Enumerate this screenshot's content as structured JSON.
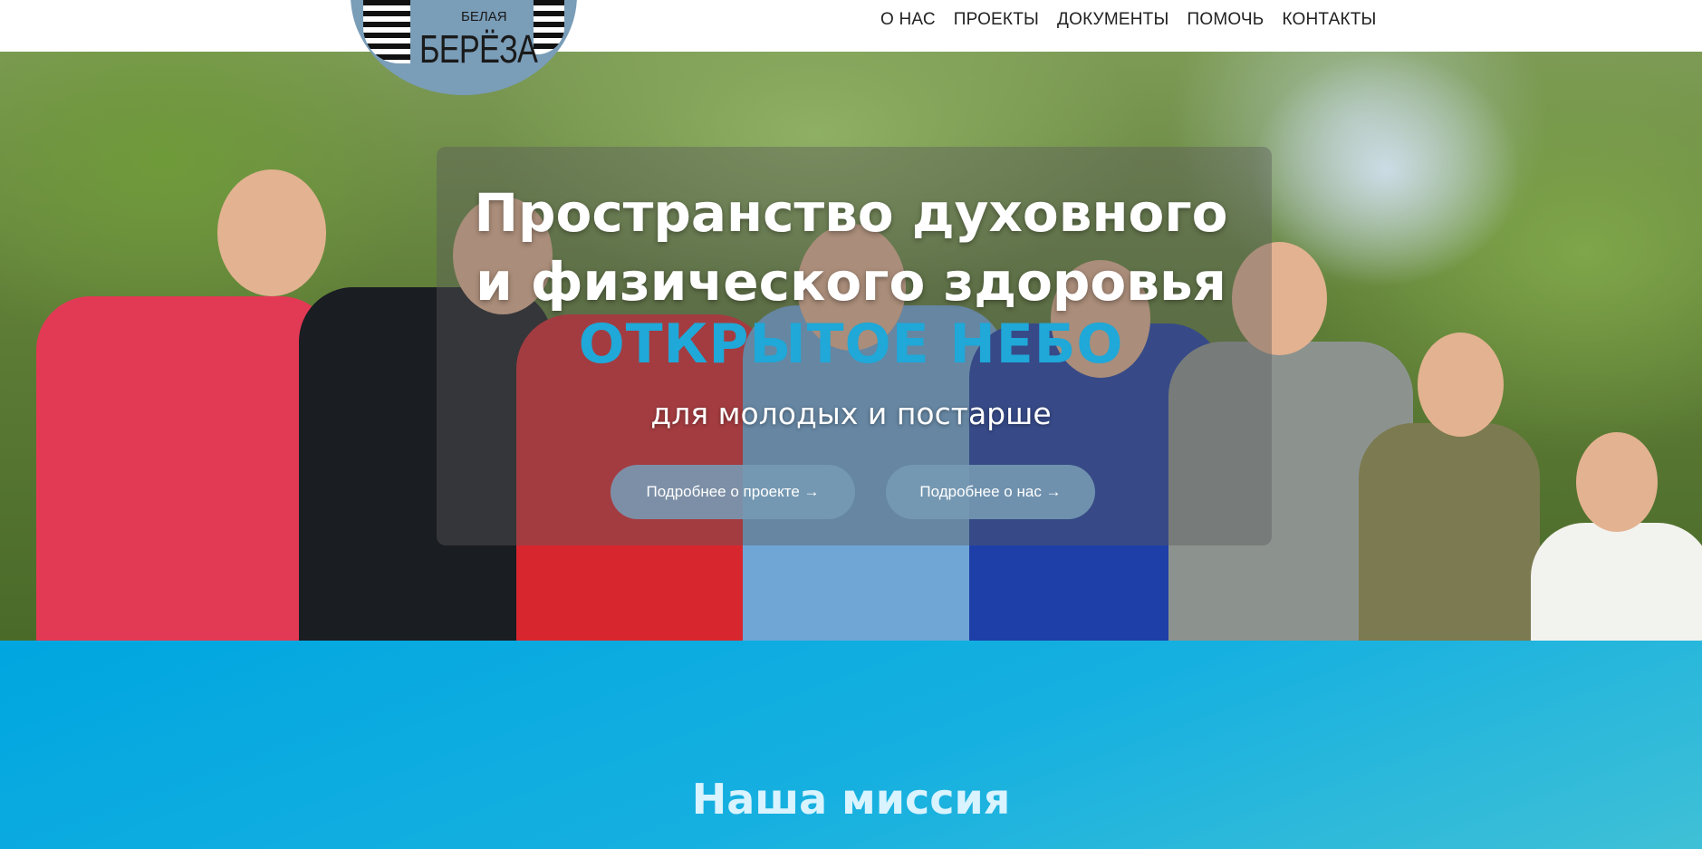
{
  "logo": {
    "small_word": "БЕЛАЯ",
    "big_word": "БЕРЁЗА"
  },
  "nav": {
    "items": [
      "О НАС",
      "ПРОЕКТЫ",
      "ДОКУМЕНТЫ",
      "ПОМОЧЬ",
      "КОНТАКТЫ"
    ]
  },
  "hero": {
    "title_line1": "Пространство духовного",
    "title_line2": "и физического здоровья",
    "accent": "ОТКРЫТОЕ НЕБО",
    "subtitle": "для молодых и постарше",
    "button_project": "Подробнее о проекте →",
    "button_about": "Подробнее о нас →"
  },
  "mission": {
    "title": "Наша миссия"
  },
  "colors": {
    "accent": "#1fa8d8",
    "mission_bg": "#00a6e0",
    "button_bg": "#7a9bb4"
  }
}
